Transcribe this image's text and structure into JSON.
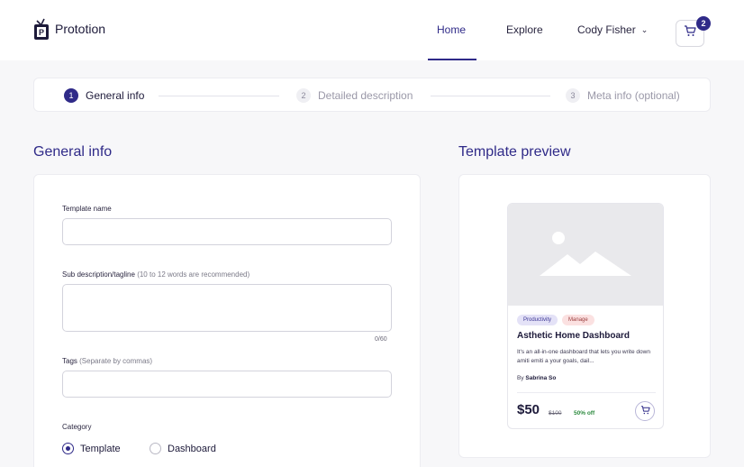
{
  "header": {
    "brand": "Prototion",
    "nav": {
      "home": "Home",
      "explore": "Explore",
      "user": "Cody Fisher"
    },
    "cart_count": "2"
  },
  "stepper": {
    "steps": [
      {
        "num": "1",
        "label": "General info"
      },
      {
        "num": "2",
        "label": "Detailed description"
      },
      {
        "num": "3",
        "label": "Meta info (optional)"
      }
    ],
    "active_step": 1
  },
  "form": {
    "title": "General info",
    "template_name": {
      "label": "Template name",
      "value": ""
    },
    "sub_description": {
      "label": "Sub description/tagline",
      "hint": "(10 to 12 words are recommended)",
      "value": "",
      "counter": "0/60"
    },
    "tags": {
      "label": "Tags",
      "hint": "(Separate by commas)",
      "value": ""
    },
    "category": {
      "label": "Category",
      "options": [
        "Template",
        "Dashboard"
      ],
      "selected": "Template"
    }
  },
  "preview": {
    "title": "Template preview",
    "card": {
      "tags": [
        "Productivity",
        "Manage"
      ],
      "name": "Asthetic Home Dashboard",
      "description": "It's an all-in-one dashboard that lets you write down amiti emiti a your goals, dail...",
      "by_prefix": "By",
      "author": "Sabrina So",
      "price": "$50",
      "old_price": "$100",
      "discount": "50% off"
    }
  },
  "colors": {
    "accent": "#2f2a88",
    "discount": "#2c8a3e"
  }
}
